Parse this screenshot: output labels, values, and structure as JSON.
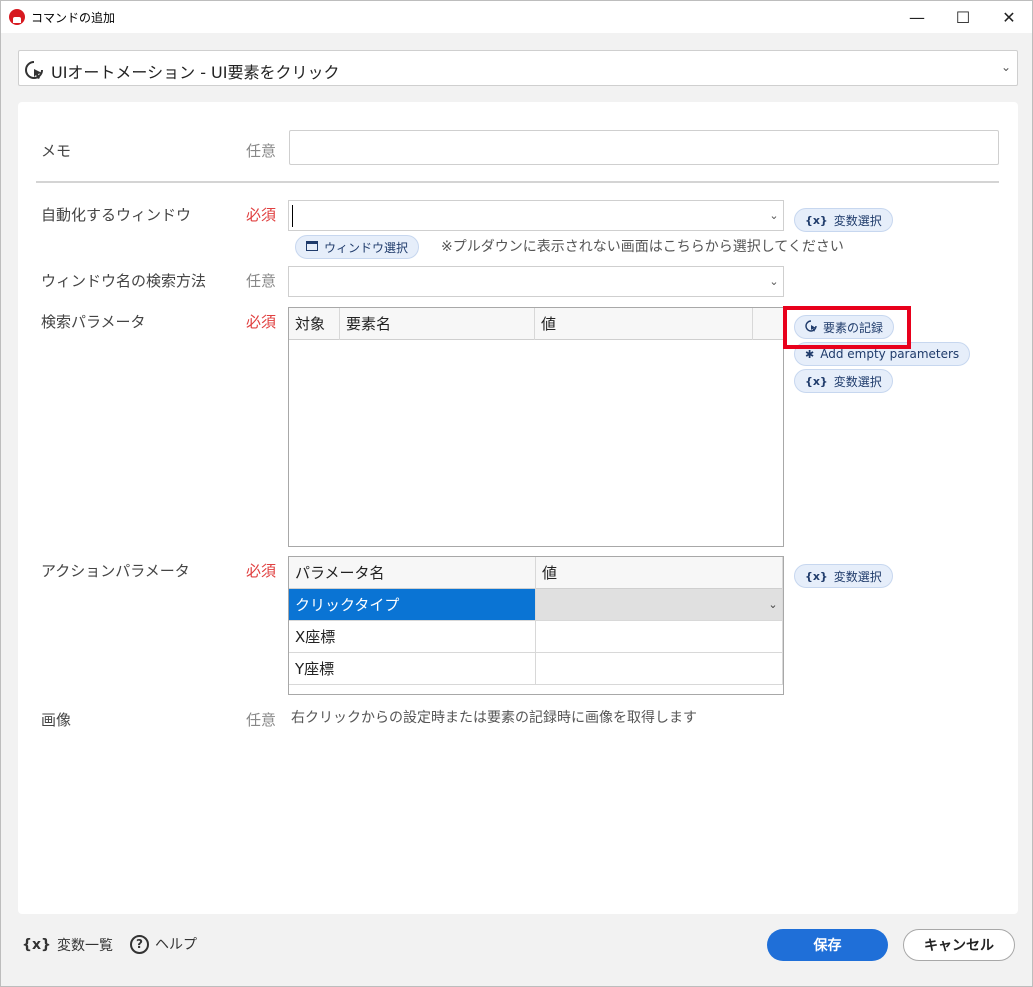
{
  "window": {
    "title": "コマンドの追加",
    "minimize": "—",
    "maximize": "☐",
    "close": "✕"
  },
  "command": {
    "selected": "UIオートメーション - UI要素をクリック"
  },
  "fields": {
    "memo": {
      "label": "メモ",
      "req": "任意",
      "value": ""
    },
    "target_window": {
      "label": "自動化するウィンドウ",
      "req": "必須",
      "value": "",
      "var_button": "変数選択",
      "select_window_button": "ウィンドウ選択",
      "hint": "※プルダウンに表示されない画面はこちらから選択してください"
    },
    "window_search": {
      "label": "ウィンドウ名の検索方法",
      "req": "任意",
      "value": ""
    },
    "search_params": {
      "label": "検索パラメータ",
      "req": "必須",
      "columns": [
        "対象",
        "要素名",
        "値"
      ],
      "rows": [],
      "record_button": "要素の記録",
      "add_empty_button": "Add empty parameters",
      "var_button": "変数選択"
    },
    "action_params": {
      "label": "アクションパラメータ",
      "req": "必須",
      "columns": [
        "パラメータ名",
        "値"
      ],
      "rows": [
        {
          "name": "クリックタイプ",
          "value": ""
        },
        {
          "name": "X座標",
          "value": ""
        },
        {
          "name": "Y座標",
          "value": ""
        }
      ],
      "var_button": "変数選択"
    },
    "image": {
      "label": "画像",
      "req": "任意",
      "description": "右クリックからの設定時または要素の記録時に画像を取得します"
    }
  },
  "footer": {
    "variables_icon": "{x}",
    "variables": "変数一覧",
    "help_icon": "?",
    "help": "ヘルプ",
    "save": "保存",
    "cancel": "キャンセル"
  },
  "icons": {
    "var_icon": "{x}",
    "add_icon": "✱"
  },
  "colors": {
    "accent": "#1f6fd8",
    "required": "#e04040",
    "selection": "#0a74d4",
    "highlight": "#e8001c"
  }
}
